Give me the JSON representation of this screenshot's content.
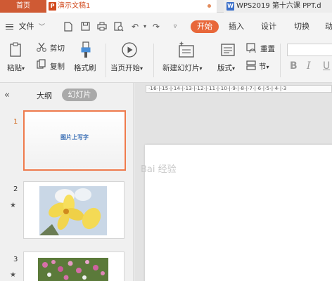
{
  "tabs": {
    "home": "首页",
    "doc1": "演示文稿1",
    "doc1_badge": "P",
    "doc2": "WPS2019 第十六课 PPT.d",
    "doc2_badge": "W"
  },
  "menu": {
    "file": "文件",
    "start": "开始",
    "insert": "插入",
    "design": "设计",
    "switch": "切换",
    "more": "动"
  },
  "ribbon": {
    "paste": "粘贴",
    "cut": "剪切",
    "copy": "复制",
    "format_painter": "格式刷",
    "from_current": "当页开始",
    "new_slide": "新建幻灯片",
    "layout": "版式",
    "reset": "重置",
    "section": "节",
    "bold": "B",
    "italic": "I",
    "underline": "U"
  },
  "panel": {
    "outline_tab": "大纲",
    "slides_tab": "幻灯片"
  },
  "slides": [
    {
      "num": "1",
      "title": "图片上写字"
    },
    {
      "num": "2",
      "star": "★"
    },
    {
      "num": "3",
      "star": "★"
    }
  ],
  "ruler_text": "·16·|·15·|·14·|·13·|·12·|·11·|·10·|·9·|·8·|·7·|·6·|·5·|·4·|·3",
  "watermark": "Bai 经验",
  "colors": {
    "accent": "#e8673a",
    "home_tab": "#cf5a34",
    "active_border": "#ee7a4c"
  }
}
